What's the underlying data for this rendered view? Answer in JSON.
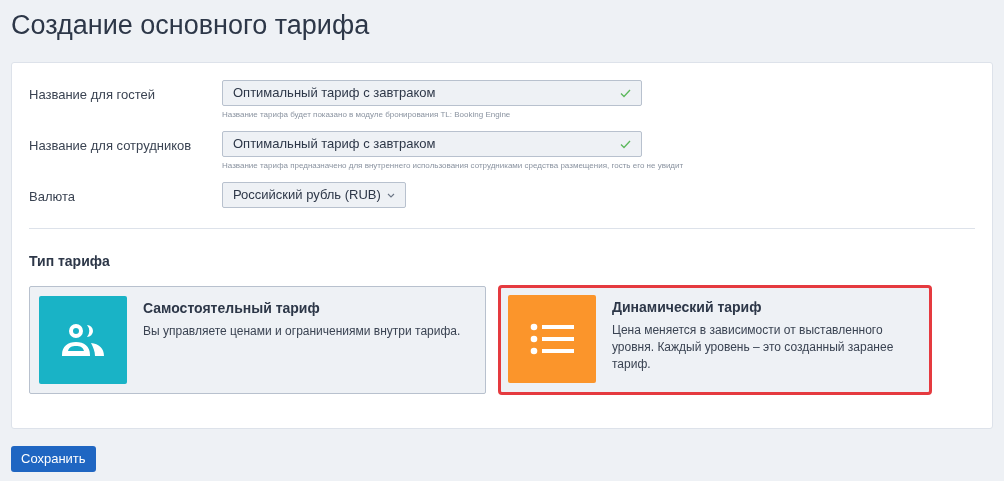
{
  "page_title": "Создание основного тарифа",
  "fields": [
    {
      "kind": "text",
      "label": "Название для гостей",
      "value": "Оптимальный тариф с завтраком",
      "valid": true,
      "hint": "Название тарифа будет показано в модуле бронирования TL: Booking Engine"
    },
    {
      "kind": "text",
      "label": "Название для сотрудников",
      "value": "Оптимальный тариф с завтраком",
      "valid": true,
      "hint": "Название тарифа предназначено для внутреннего использования сотрудниками средства размещения, гость его не увидит"
    },
    {
      "kind": "select",
      "label": "Валюта",
      "value": "Российский рубль (RUB)"
    }
  ],
  "tariff_type": {
    "heading": "Тип тарифа",
    "options": [
      {
        "kind": "people",
        "title": "Самостоятельный тариф",
        "description": "Вы управляете ценами и ограничениями внутри тарифа.",
        "selected": false
      },
      {
        "kind": "list",
        "title": "Динамический тариф",
        "description": "Цена меняется в зависимости от выставленного уровня. Каждый уровень – это созданный заранее тариф.",
        "selected": true
      }
    ]
  },
  "save_button": "Сохранить"
}
